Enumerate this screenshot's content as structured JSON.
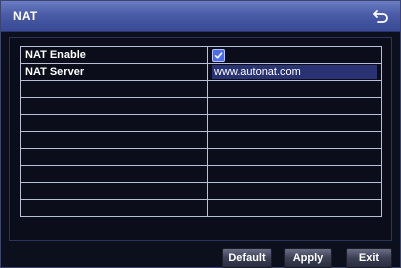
{
  "window": {
    "title": "NAT",
    "back_icon": "back-arrow-icon"
  },
  "table": {
    "rows": [
      {
        "label": "NAT Enable",
        "value_type": "checkbox",
        "checked": true
      },
      {
        "label": "NAT Server",
        "value_type": "input",
        "value": "www.autonat.com"
      },
      {
        "label": "",
        "value": ""
      },
      {
        "label": "",
        "value": ""
      },
      {
        "label": "",
        "value": ""
      },
      {
        "label": "",
        "value": ""
      },
      {
        "label": "",
        "value": ""
      },
      {
        "label": "",
        "value": ""
      },
      {
        "label": "",
        "value": ""
      },
      {
        "label": "",
        "value": ""
      }
    ]
  },
  "buttons": {
    "default": "Default",
    "apply": "Apply",
    "exit": "Exit"
  },
  "colors": {
    "titlebar": "#4a5ba7",
    "background": "#0c0f1c",
    "input_bg": "#293272",
    "checkbox": "#4a6df0"
  }
}
